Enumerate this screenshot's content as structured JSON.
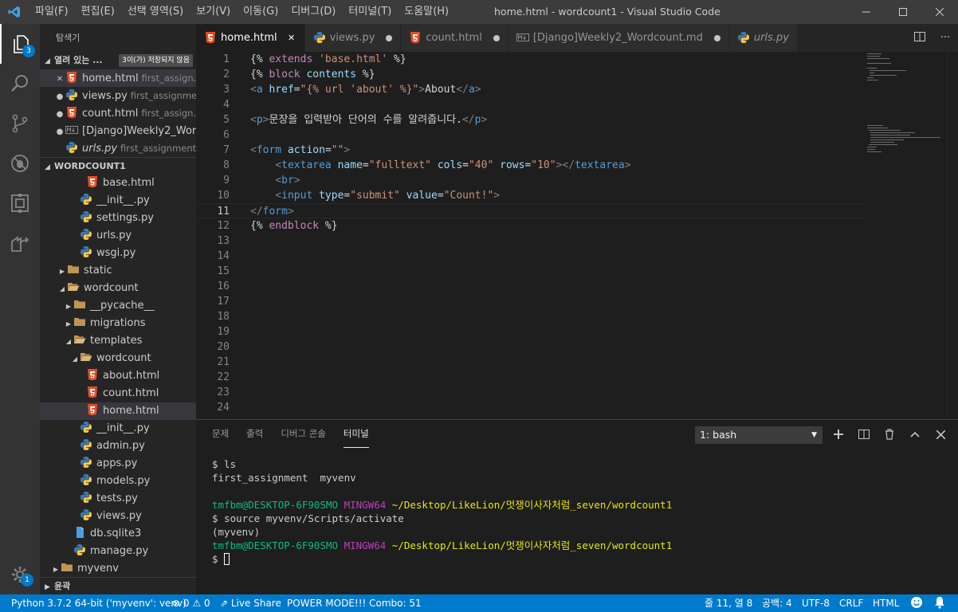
{
  "titlebar": {
    "menu": [
      "파일(F)",
      "편집(E)",
      "선택 영역(S)",
      "보기(V)",
      "이동(G)",
      "디버그(D)",
      "터미널(T)",
      "도움말(H)"
    ],
    "title": "home.html - wordcount1 - Visual Studio Code"
  },
  "activity": {
    "explorer_badge": "3",
    "settings_badge": "1"
  },
  "sidebar": {
    "title": "탐색기",
    "open_editors": {
      "label": "열려 있는 ...",
      "badge": "3이(가) 저장되지 않음",
      "items": [
        {
          "name": "home.html",
          "desc": "first_assign...",
          "mark": "✕",
          "icon": "html5-icon"
        },
        {
          "name": "views.py",
          "desc": "first_assignme...",
          "mark": "●",
          "icon": "python-icon"
        },
        {
          "name": "count.html",
          "desc": "first_assign...",
          "mark": "●",
          "icon": "html5-icon"
        },
        {
          "name": "[Django]Weekly2_Wor...",
          "desc": "",
          "mark": "●",
          "icon": "markdown-icon"
        },
        {
          "name": "urls.py",
          "desc": "first_assignment\\...",
          "mark": "",
          "icon": "python-icon"
        }
      ]
    },
    "workspace": {
      "label": "WORDCOUNT1",
      "tree": [
        {
          "name": "base.html",
          "icon": "html5-icon",
          "indent": 4,
          "twisty": ""
        },
        {
          "name": "__init__.py",
          "icon": "python-icon",
          "indent": 3,
          "twisty": ""
        },
        {
          "name": "settings.py",
          "icon": "python-icon",
          "indent": 3,
          "twisty": ""
        },
        {
          "name": "urls.py",
          "icon": "python-icon",
          "indent": 3,
          "twisty": ""
        },
        {
          "name": "wsgi.py",
          "icon": "python-icon",
          "indent": 3,
          "twisty": ""
        },
        {
          "name": "static",
          "icon": "folder-icon",
          "indent": 1,
          "twisty": "▶"
        },
        {
          "name": "wordcount",
          "icon": "folder-open-icon",
          "indent": 1,
          "twisty": "◢"
        },
        {
          "name": "__pycache__",
          "icon": "folder-icon",
          "indent": 2,
          "twisty": "▶"
        },
        {
          "name": "migrations",
          "icon": "folder-icon",
          "indent": 2,
          "twisty": "▶"
        },
        {
          "name": "templates",
          "icon": "folder-open-icon",
          "indent": 2,
          "twisty": "◢"
        },
        {
          "name": "wordcount",
          "icon": "folder-open-icon",
          "indent": 3,
          "twisty": "◢"
        },
        {
          "name": "about.html",
          "icon": "html5-icon",
          "indent": 4,
          "twisty": ""
        },
        {
          "name": "count.html",
          "icon": "html5-icon",
          "indent": 4,
          "twisty": ""
        },
        {
          "name": "home.html",
          "icon": "html5-icon",
          "indent": 4,
          "twisty": "",
          "selected": true
        },
        {
          "name": "__init__.py",
          "icon": "python-icon",
          "indent": 3,
          "twisty": ""
        },
        {
          "name": "admin.py",
          "icon": "python-icon",
          "indent": 3,
          "twisty": ""
        },
        {
          "name": "apps.py",
          "icon": "python-icon",
          "indent": 3,
          "twisty": ""
        },
        {
          "name": "models.py",
          "icon": "python-icon",
          "indent": 3,
          "twisty": ""
        },
        {
          "name": "tests.py",
          "icon": "python-icon",
          "indent": 3,
          "twisty": ""
        },
        {
          "name": "views.py",
          "icon": "python-icon",
          "indent": 3,
          "twisty": ""
        },
        {
          "name": "db.sqlite3",
          "icon": "database-icon",
          "indent": 2,
          "twisty": ""
        },
        {
          "name": "manage.py",
          "icon": "python-icon",
          "indent": 2,
          "twisty": ""
        },
        {
          "name": "myvenv",
          "icon": "folder-icon",
          "indent": 0,
          "twisty": "▶"
        }
      ]
    },
    "outline_label": "윤곽"
  },
  "tabs": [
    {
      "name": "home.html",
      "icon": "html5-icon",
      "active": true,
      "state": "close"
    },
    {
      "name": "views.py",
      "icon": "python-icon",
      "active": false,
      "state": "dirty"
    },
    {
      "name": "count.html",
      "icon": "html5-icon",
      "active": false,
      "state": "dirty"
    },
    {
      "name": "[Django]Weekly2_Wordcount.md",
      "icon": "markdown-icon",
      "active": false,
      "state": "dirty"
    },
    {
      "name": "urls.py",
      "icon": "python-icon",
      "active": false,
      "state": "none",
      "italic": true
    }
  ],
  "editor": {
    "current_line": 11,
    "total_lines": 24,
    "lines": [
      [
        [
          "{% ",
          "br"
        ],
        [
          "extends",
          "kw"
        ],
        [
          " ",
          "txt"
        ],
        [
          "'base.html'",
          "str"
        ],
        [
          " %}",
          "br"
        ]
      ],
      [
        [
          "{% ",
          "br"
        ],
        [
          "block",
          "kw"
        ],
        [
          " ",
          "txt"
        ],
        [
          "contents",
          "attr"
        ],
        [
          " %}",
          "br"
        ]
      ],
      [
        [
          "<",
          "gray"
        ],
        [
          "a",
          "tag"
        ],
        [
          " ",
          "txt"
        ],
        [
          "href",
          "attr"
        ],
        [
          "=",
          "txt"
        ],
        [
          "\"{% url 'about' %}\"",
          "str"
        ],
        [
          ">",
          "gray"
        ],
        [
          "About",
          "txt"
        ],
        [
          "</",
          "gray"
        ],
        [
          "a",
          "tag"
        ],
        [
          ">",
          "gray"
        ]
      ],
      [],
      [
        [
          "<",
          "gray"
        ],
        [
          "p",
          "tag"
        ],
        [
          ">",
          "gray"
        ],
        [
          "문장을 입력받아 단어의 수를 알려줍니다.",
          "txt"
        ],
        [
          "</",
          "gray"
        ],
        [
          "p",
          "tag"
        ],
        [
          ">",
          "gray"
        ]
      ],
      [],
      [
        [
          "<",
          "gray"
        ],
        [
          "form",
          "tag"
        ],
        [
          " ",
          "txt"
        ],
        [
          "action",
          "attr"
        ],
        [
          "=",
          "txt"
        ],
        [
          "\"\"",
          "str"
        ],
        [
          ">",
          "gray"
        ]
      ],
      [
        [
          "    <",
          "gray"
        ],
        [
          "textarea",
          "tag"
        ],
        [
          " ",
          "txt"
        ],
        [
          "name",
          "attr"
        ],
        [
          "=",
          "txt"
        ],
        [
          "\"fulltext\"",
          "str"
        ],
        [
          " ",
          "txt"
        ],
        [
          "cols",
          "attr"
        ],
        [
          "=",
          "txt"
        ],
        [
          "\"40\"",
          "str"
        ],
        [
          " ",
          "txt"
        ],
        [
          "rows",
          "attr"
        ],
        [
          "=",
          "txt"
        ],
        [
          "\"10\"",
          "str"
        ],
        [
          "></",
          "gray"
        ],
        [
          "textarea",
          "tag"
        ],
        [
          ">",
          "gray"
        ]
      ],
      [
        [
          "    <",
          "gray"
        ],
        [
          "br",
          "tag"
        ],
        [
          ">",
          "gray"
        ]
      ],
      [
        [
          "    <",
          "gray"
        ],
        [
          "input",
          "tag"
        ],
        [
          " ",
          "txt"
        ],
        [
          "type",
          "attr"
        ],
        [
          "=",
          "txt"
        ],
        [
          "\"submit\"",
          "str"
        ],
        [
          " ",
          "txt"
        ],
        [
          "value",
          "attr"
        ],
        [
          "=",
          "txt"
        ],
        [
          "\"Count!\"",
          "str"
        ],
        [
          ">",
          "gray"
        ]
      ],
      [
        [
          "</",
          "gray"
        ],
        [
          "form",
          "tag"
        ],
        [
          ">",
          "gray"
        ]
      ],
      [
        [
          "{% ",
          "br"
        ],
        [
          "endblock",
          "kw"
        ],
        [
          " %}",
          "br"
        ]
      ]
    ]
  },
  "panel": {
    "tabs": [
      "문제",
      "출력",
      "디버그 콘솔",
      "터미널"
    ],
    "active_tab": "터미널",
    "terminal_select": "1: bash",
    "terminal": [
      [
        [
          "$ ls",
          ""
        ]
      ],
      [
        [
          "first_assignment  myvenv",
          ""
        ]
      ],
      [],
      [
        [
          "tmfbm@DESKTOP-6F90SMO",
          "green"
        ],
        [
          " ",
          ""
        ],
        [
          "MINGW64",
          "mag"
        ],
        [
          " ",
          ""
        ],
        [
          "~/Desktop/LikeLion/멋쟁이사자처럼_seven/wordcount1",
          "yel"
        ]
      ],
      [
        [
          "$ source myvenv/Scripts/activate",
          ""
        ]
      ],
      [
        [
          "(myvenv)",
          ""
        ]
      ],
      [
        [
          "tmfbm@DESKTOP-6F90SMO",
          "green"
        ],
        [
          " ",
          ""
        ],
        [
          "MINGW64",
          "mag"
        ],
        [
          " ",
          ""
        ],
        [
          "~/Desktop/LikeLion/멋쟁이사자처럼_seven/wordcount1",
          "yel"
        ]
      ],
      [
        [
          "$ ",
          ""
        ],
        [
          "",
          "cursor"
        ]
      ]
    ]
  },
  "statusbar": {
    "python": "Python 3.7.2 64-bit ('myvenv': venv)",
    "errors": "0",
    "warnings": "0",
    "liveshare": "Live Share",
    "power": "POWER MODE!!! Combo: 51",
    "position": "줄 11, 열 8",
    "spaces": "공백: 4",
    "encoding": "UTF-8",
    "eol": "CRLF",
    "language": "HTML"
  }
}
